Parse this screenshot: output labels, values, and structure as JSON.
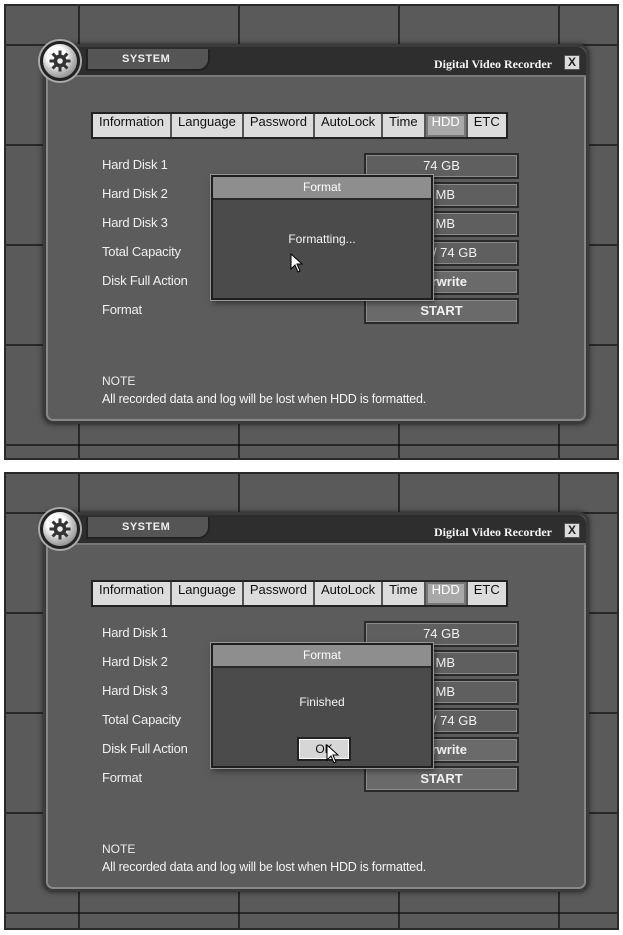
{
  "screens": [
    {
      "window": {
        "title_tab": "SYSTEM",
        "app_title": "Digital Video Recorder",
        "close_label": "X"
      },
      "tabs": [
        "Information",
        "Language",
        "Password",
        "AutoLock",
        "Time",
        "HDD",
        "ETC"
      ],
      "active_tab": "HDD",
      "rows": [
        {
          "label": "Hard Disk 1",
          "value": "74 GB"
        },
        {
          "label": "Hard Disk 2",
          "value": "MB"
        },
        {
          "label": "Hard Disk 3",
          "value": "MB"
        },
        {
          "label": "Total Capacity",
          "value": "/ 74 GB"
        },
        {
          "label": "Disk Full Action",
          "value": "rwrite"
        },
        {
          "label": "Format",
          "value": "START"
        }
      ],
      "note": {
        "title": "NOTE",
        "text": "All recorded data and log will be lost when HDD is formatted."
      },
      "dialog": {
        "title": "Format",
        "message": "Formatting...",
        "ok_label": ""
      }
    },
    {
      "window": {
        "title_tab": "SYSTEM",
        "app_title": "Digital Video Recorder",
        "close_label": "X"
      },
      "tabs": [
        "Information",
        "Language",
        "Password",
        "AutoLock",
        "Time",
        "HDD",
        "ETC"
      ],
      "active_tab": "HDD",
      "rows": [
        {
          "label": "Hard Disk 1",
          "value": "74 GB"
        },
        {
          "label": "Hard Disk 2",
          "value": "MB"
        },
        {
          "label": "Hard Disk 3",
          "value": "MB"
        },
        {
          "label": "Total Capacity",
          "value": "/ 74 GB"
        },
        {
          "label": "Disk Full Action",
          "value": "rwrite"
        },
        {
          "label": "Format",
          "value": "START"
        }
      ],
      "note": {
        "title": "NOTE",
        "text": "All recorded data and log will be lost when HDD is formatted."
      },
      "dialog": {
        "title": "Format",
        "message": "Finished",
        "ok_label": "OK"
      }
    }
  ],
  "icons": {
    "gear": "gear-icon",
    "cursor": "mouse-pointer-icon"
  }
}
